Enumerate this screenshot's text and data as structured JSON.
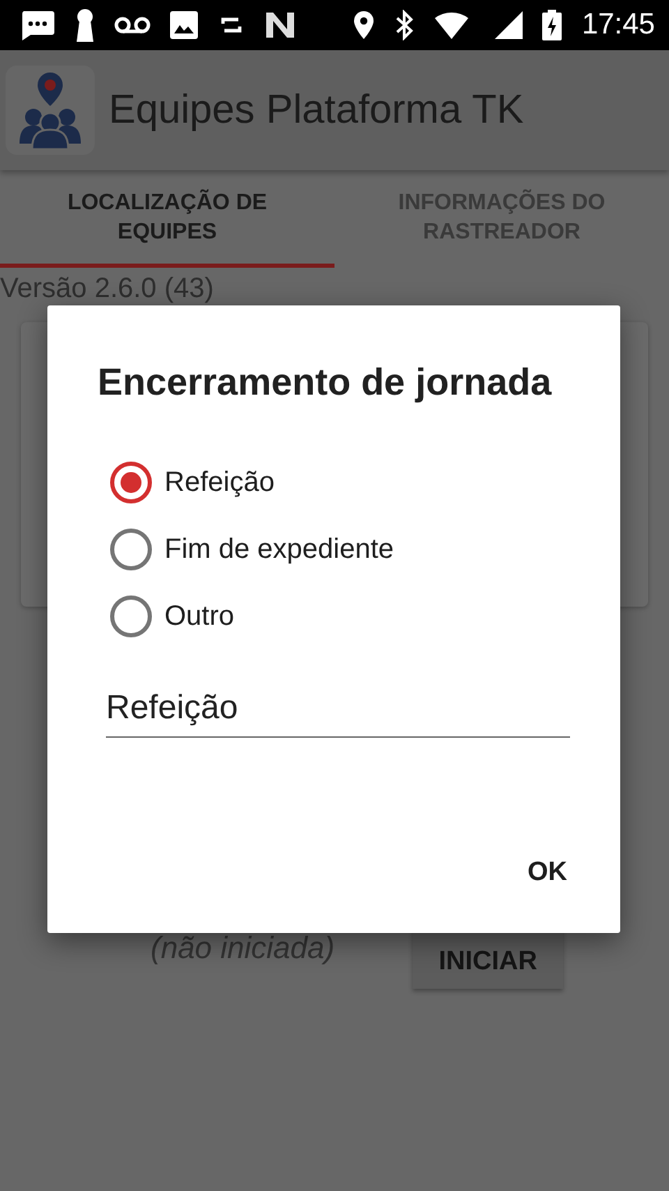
{
  "status_bar": {
    "time": "17:45"
  },
  "app_bar": {
    "title": "Equipes Plataforma TK"
  },
  "tabs": [
    {
      "label": "LOCALIZAÇÃO DE EQUIPES",
      "selected": true
    },
    {
      "label": "INFORMAÇÕES DO RASTREADOR",
      "selected": false
    }
  ],
  "version": "Versão 2.6.0 (43)",
  "journey": {
    "status": "(não iniciada)",
    "button": "INICIAR"
  },
  "dialog": {
    "title": "Encerramento de jornada",
    "options": [
      {
        "label": "Refeição",
        "selected": true
      },
      {
        "label": "Fim de expediente",
        "selected": false
      },
      {
        "label": "Outro",
        "selected": false
      }
    ],
    "field": {
      "value": "Refeição"
    },
    "buttons": [
      "OK"
    ]
  }
}
